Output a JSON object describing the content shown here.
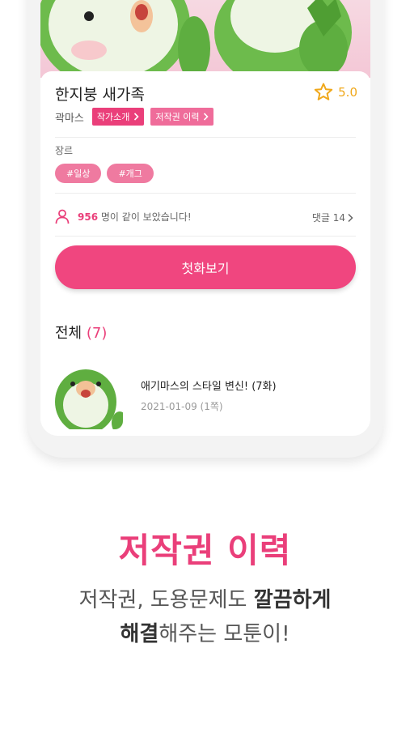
{
  "webtoon": {
    "title": "한지붕 새가족",
    "rating": "5.0",
    "author": "곽마스",
    "author_intro_label": "작가소개",
    "copyright_label": "저작권 이력",
    "genre_label": "장르",
    "tags": [
      "#일상",
      "#개그"
    ],
    "viewer_count": "956",
    "viewer_text": "명이 같이 보았습니다!",
    "comments_label": "댓글 14",
    "cta_label": "첫화보기",
    "all_label": "전체",
    "all_count": "(7)",
    "episodes": [
      {
        "title": "애기마스의 스타일 변신! (7화)",
        "meta": "2021-01-09 (1쪽)"
      }
    ]
  },
  "promo": {
    "title": "저작권 이력",
    "line1": "저작권, 도용문제도 ",
    "line1_bold": "깔끔하게",
    "line2_bold": "해결",
    "line2": "해주는 모툰이!"
  },
  "colors": {
    "accent": "#ea3f7a",
    "star": "#f0a81b",
    "cta": "#f0467f"
  },
  "icons": [
    "star-icon",
    "chevron-right-icon",
    "user-icon"
  ]
}
